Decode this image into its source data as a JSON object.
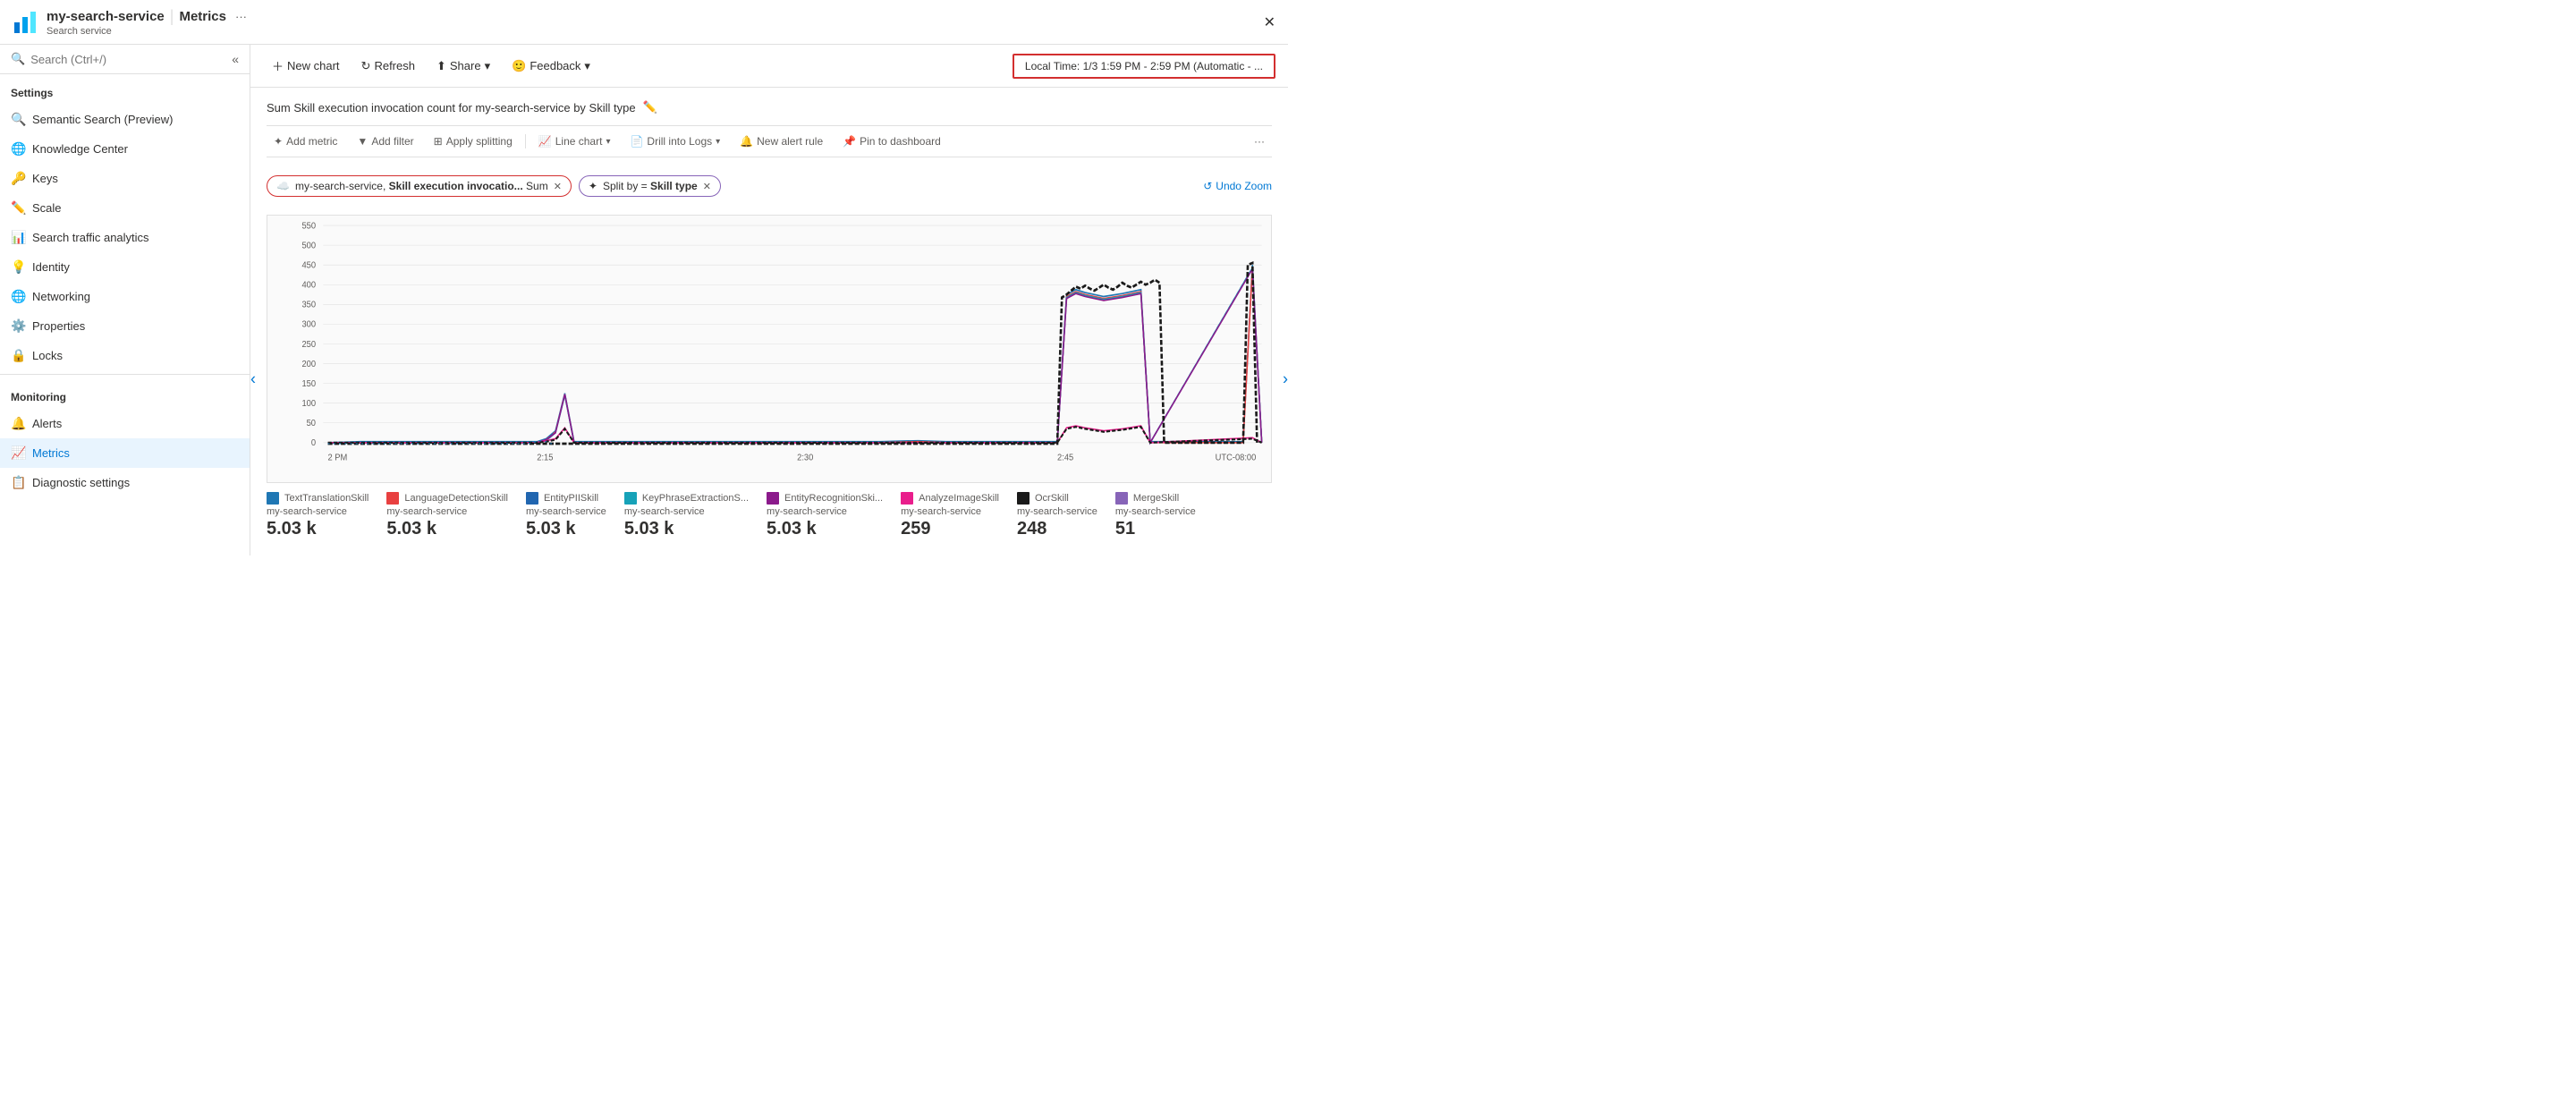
{
  "titleBar": {
    "icon": "📊",
    "serviceName": "my-search-service",
    "separator": "|",
    "pageTitle": "Metrics",
    "dots": "···",
    "subtitle": "Search service",
    "close": "✕"
  },
  "toolbar": {
    "newChart": "New chart",
    "refresh": "Refresh",
    "share": "Share",
    "feedback": "Feedback",
    "timeRange": "Local Time: 1/3 1:59 PM - 2:59 PM (Automatic - ..."
  },
  "sidebar": {
    "searchPlaceholder": "Search (Ctrl+/)",
    "sections": [
      {
        "label": "Settings",
        "items": [
          {
            "id": "semantic-search",
            "icon": "🔍",
            "label": "Semantic Search (Preview)"
          },
          {
            "id": "knowledge-center",
            "icon": "🌐",
            "label": "Knowledge Center"
          },
          {
            "id": "keys",
            "icon": "🔑",
            "label": "Keys"
          },
          {
            "id": "scale",
            "icon": "✏️",
            "label": "Scale"
          },
          {
            "id": "search-traffic",
            "icon": "📊",
            "label": "Search traffic analytics"
          },
          {
            "id": "identity",
            "icon": "💡",
            "label": "Identity"
          },
          {
            "id": "networking",
            "icon": "🌐",
            "label": "Networking"
          },
          {
            "id": "properties",
            "icon": "⚙️",
            "label": "Properties"
          },
          {
            "id": "locks",
            "icon": "🔒",
            "label": "Locks"
          }
        ]
      },
      {
        "label": "Monitoring",
        "items": [
          {
            "id": "alerts",
            "icon": "🔔",
            "label": "Alerts"
          },
          {
            "id": "metrics",
            "icon": "📈",
            "label": "Metrics",
            "active": true
          },
          {
            "id": "diagnostic",
            "icon": "📋",
            "label": "Diagnostic settings"
          }
        ]
      }
    ]
  },
  "chartArea": {
    "title": "Sum Skill execution invocation count for my-search-service by Skill type",
    "filterTags": [
      {
        "id": "metric-tag",
        "icon": "☁️",
        "text": "my-search-service, Skill execution invocatio... Sum",
        "removable": true
      },
      {
        "id": "split-tag",
        "icon": "✦",
        "text": "Split by = Skill type",
        "removable": true
      }
    ],
    "chartToolbar": {
      "addMetric": "Add metric",
      "addFilter": "Add filter",
      "applySplitting": "Apply splitting",
      "lineChart": "Line chart",
      "drillIntoLogs": "Drill into Logs",
      "newAlertRule": "New alert rule",
      "pinToDashboard": "Pin to dashboard"
    },
    "undoZoom": "Undo Zoom",
    "yAxisLabels": [
      "550",
      "500",
      "450",
      "400",
      "350",
      "300",
      "250",
      "200",
      "150",
      "100",
      "50",
      "0"
    ],
    "xAxisLabels": [
      "2 PM",
      "2:15",
      "2:30",
      "2:45",
      "UTC-08:00"
    ],
    "legend": [
      {
        "id": "text-translation",
        "color": "#1f77b4",
        "label": "TextTranslationSkill",
        "service": "my-search-service",
        "value": "5.03 k"
      },
      {
        "id": "language-detection",
        "color": "#e84040",
        "label": "LanguageDetectionSkill",
        "service": "my-search-service",
        "value": "5.03 k"
      },
      {
        "id": "entity-pii",
        "color": "#2166b0",
        "label": "EntityPIISkill",
        "service": "my-search-service",
        "value": "5.03 k"
      },
      {
        "id": "key-phrase",
        "color": "#17a2b8",
        "label": "KeyPhraseExtractionS...",
        "service": "my-search-service",
        "value": "5.03 k"
      },
      {
        "id": "entity-recognition",
        "color": "#8b1a8b",
        "label": "EntityRecognitionSki...",
        "service": "my-search-service",
        "value": "5.03 k"
      },
      {
        "id": "analyze-image",
        "color": "#e84040",
        "label": "AnalyzeImageSkill",
        "service": "my-search-service",
        "value": "259"
      },
      {
        "id": "ocr",
        "color": "#323130",
        "label": "OcrSkill",
        "service": "my-search-service",
        "value": "248"
      },
      {
        "id": "merge",
        "color": "#8764b8",
        "label": "MergeSkill",
        "service": "my-search-service",
        "value": "51"
      }
    ]
  }
}
